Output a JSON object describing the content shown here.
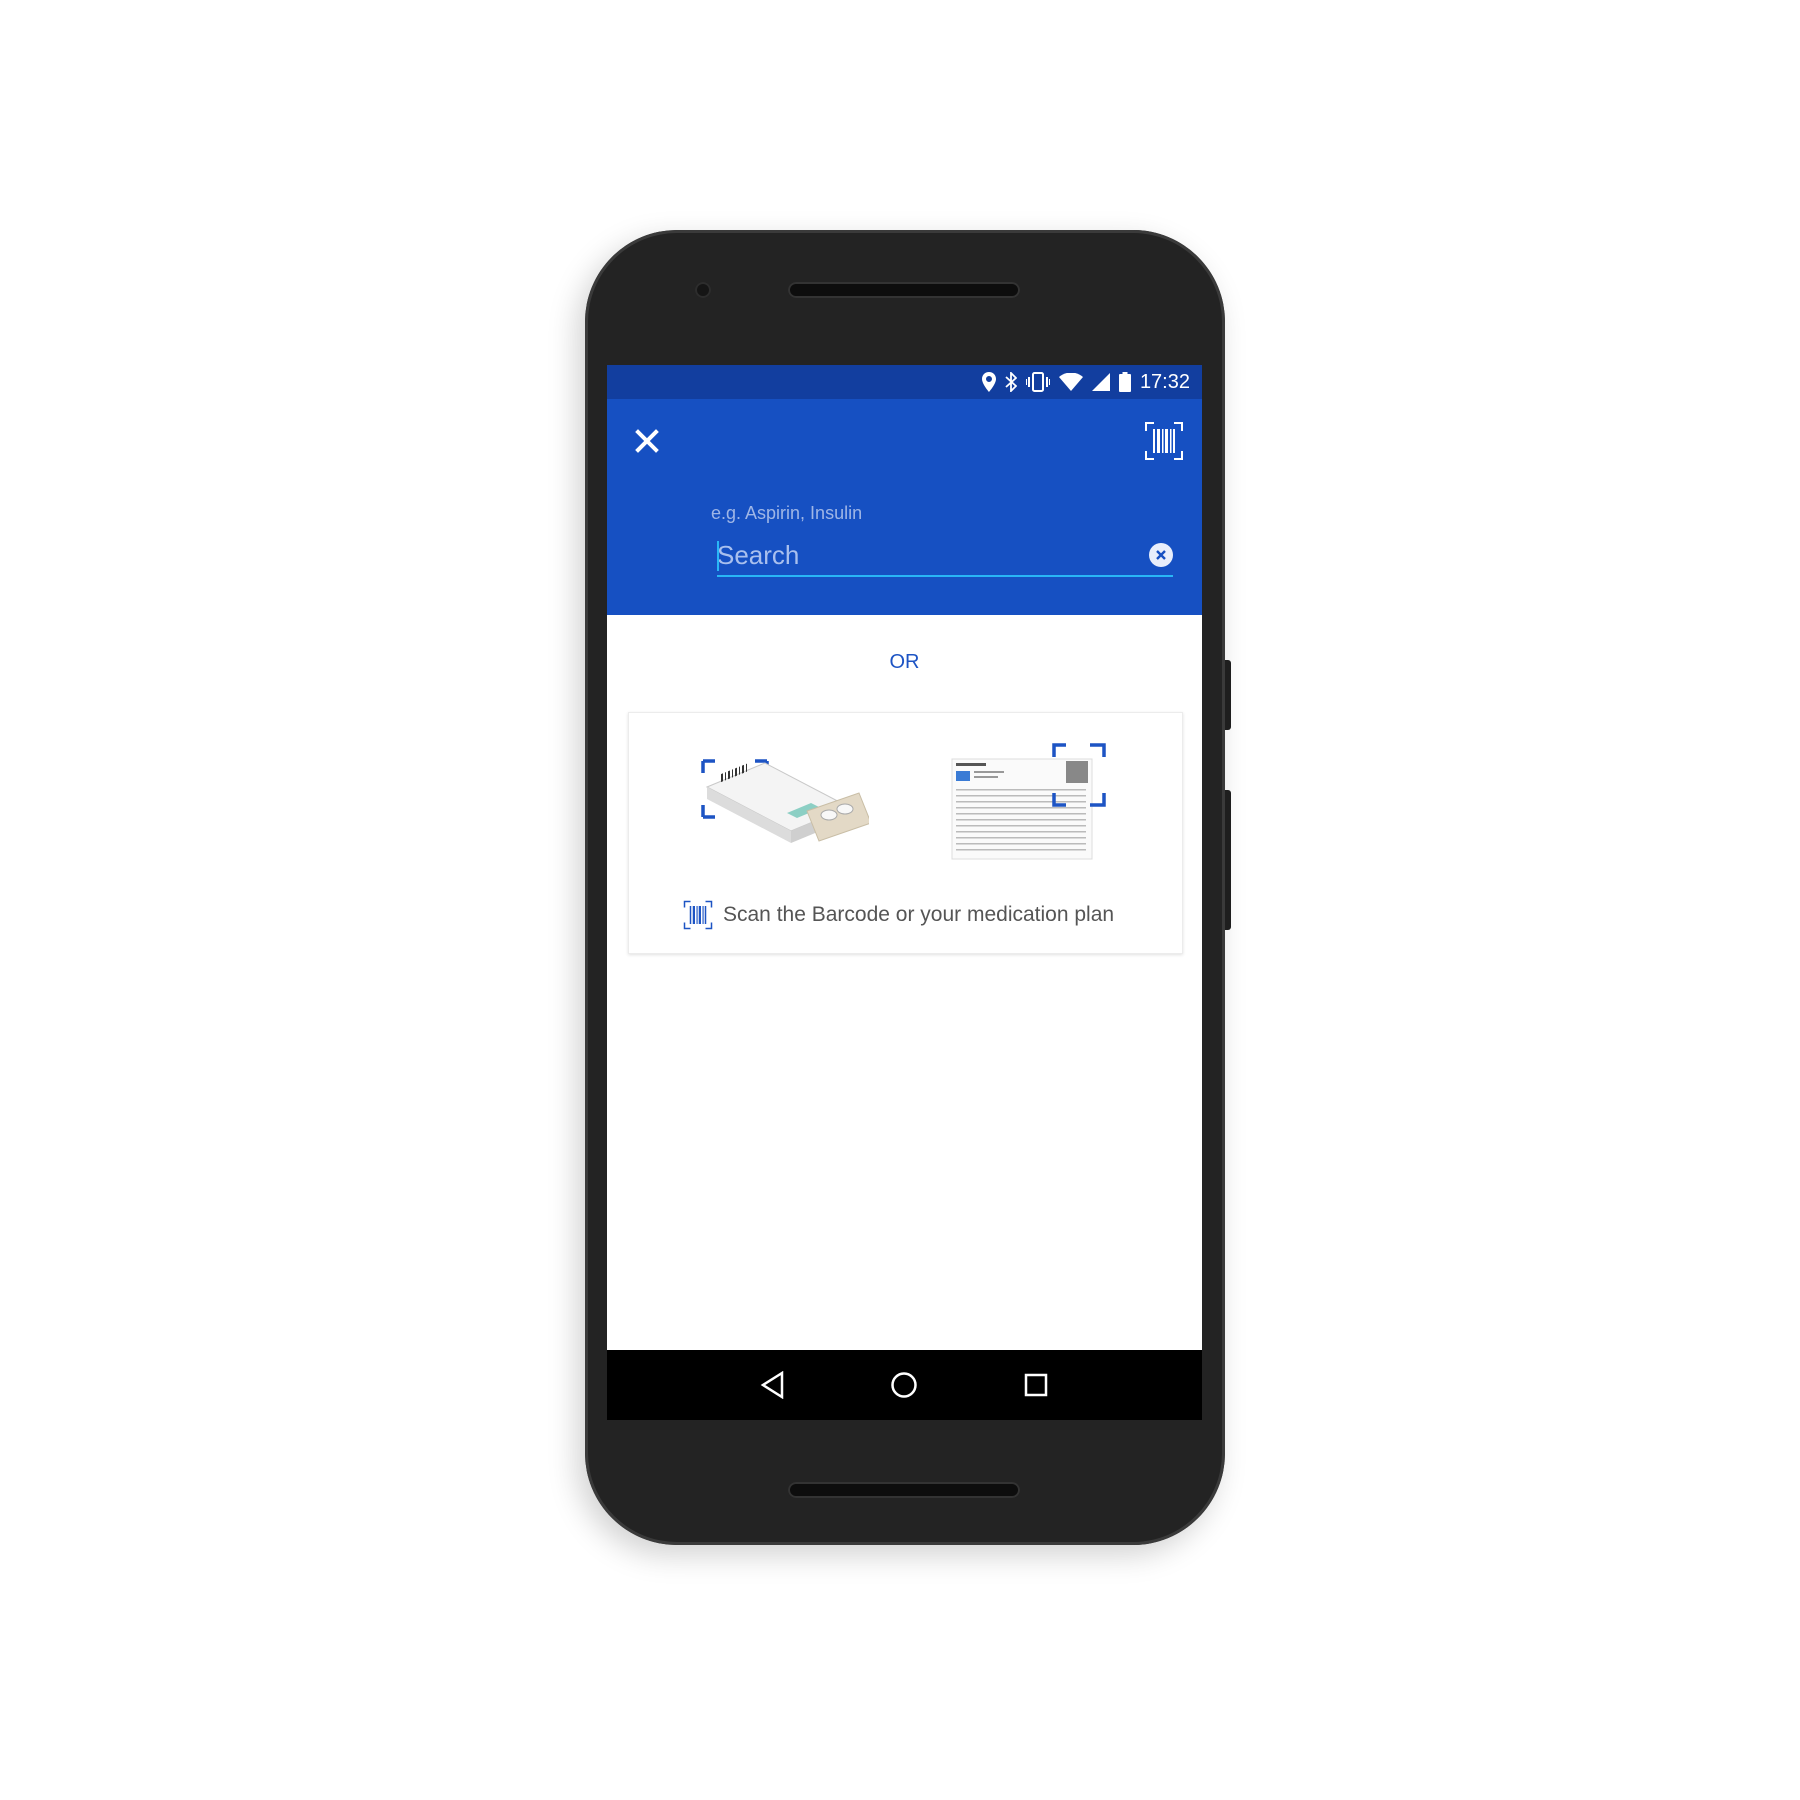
{
  "status_bar": {
    "time": "17:32",
    "icons": [
      "location-icon",
      "bluetooth-icon",
      "vibrate-icon",
      "wifi-icon",
      "signal-icon",
      "battery-icon"
    ]
  },
  "app_bar": {
    "close_icon": "close-icon",
    "scan_icon": "barcode-scan-icon",
    "search": {
      "hint": "e.g. Aspirin, Insulin",
      "placeholder": "Search",
      "value": "",
      "clear_icon": "clear-circle-icon"
    }
  },
  "content": {
    "or_label": "OR",
    "scan_card": {
      "label": "Scan the Barcode or your medication plan",
      "icon": "barcode-icon"
    }
  },
  "nav_bar": {
    "back_icon": "back-icon",
    "home_icon": "home-icon",
    "recents_icon": "recents-icon"
  },
  "colors": {
    "status_bar": "#123e9f",
    "app_bar": "#1650c2",
    "accent": "#29b6f6",
    "link": "#1d54c4"
  }
}
